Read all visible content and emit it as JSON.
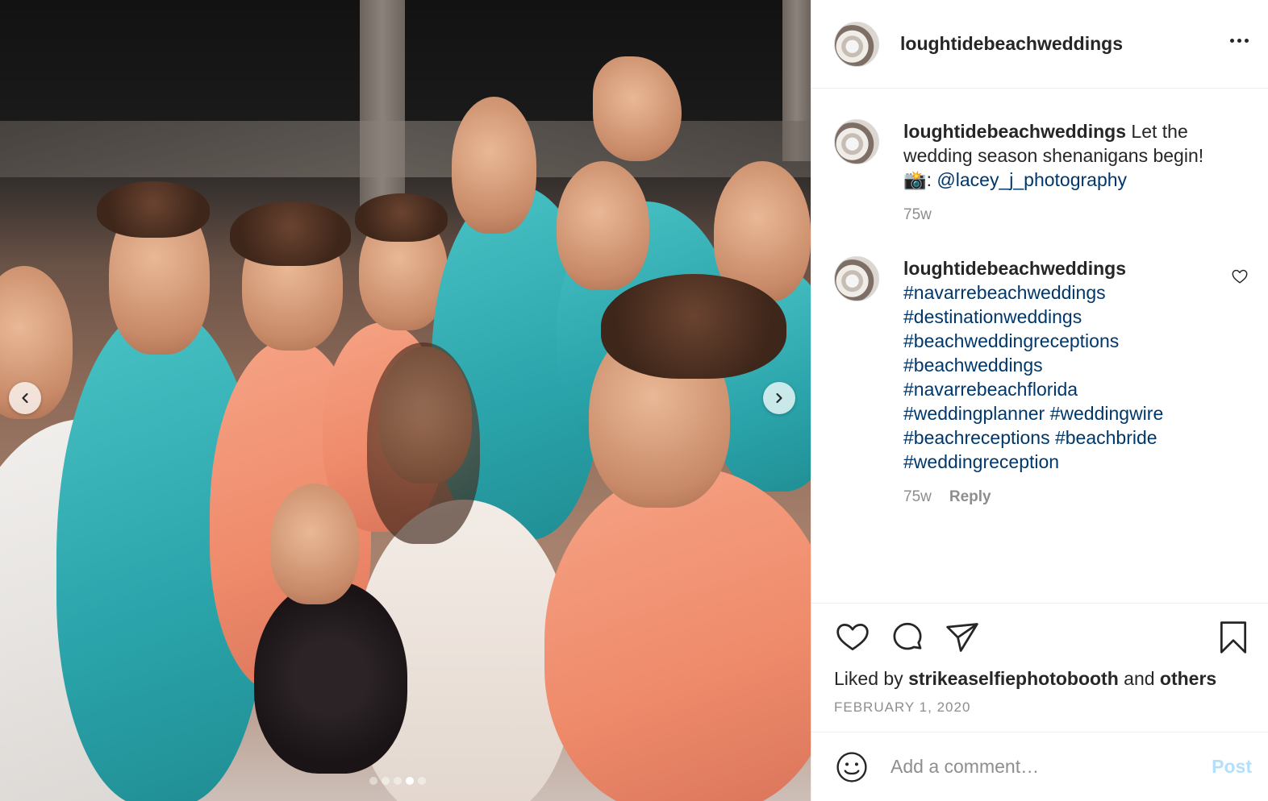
{
  "header": {
    "username": "loughtidebeachweddings"
  },
  "caption": {
    "username": "loughtidebeachweddings",
    "text": " Let the wedding season shenanigans begin! 📸: ",
    "mention": "@lacey_j_photography",
    "age": "75w"
  },
  "comment": {
    "username": "loughtidebeachweddings",
    "hashtags": [
      "#navarrebeachweddings",
      "#destinationweddings",
      "#beachweddingreceptions",
      "#beachweddings",
      "#navarrebeachflorida",
      "#weddingplanner",
      "#weddingwire",
      "#beachreceptions",
      "#beachbride",
      "#weddingreception"
    ],
    "age": "75w",
    "reply_label": "Reply"
  },
  "likes": {
    "prefix": "Liked by ",
    "user": "strikeaselfiephotobooth",
    "middle": " and ",
    "others": "others"
  },
  "date": "FEBRUARY 1, 2020",
  "add_comment": {
    "placeholder": "Add a comment…",
    "post_label": "Post"
  },
  "carousel": {
    "total": 5,
    "active_index": 3
  },
  "colors": {
    "link": "#00376b",
    "muted": "#8e8e8e",
    "post_disabled": "#b2dffc"
  }
}
